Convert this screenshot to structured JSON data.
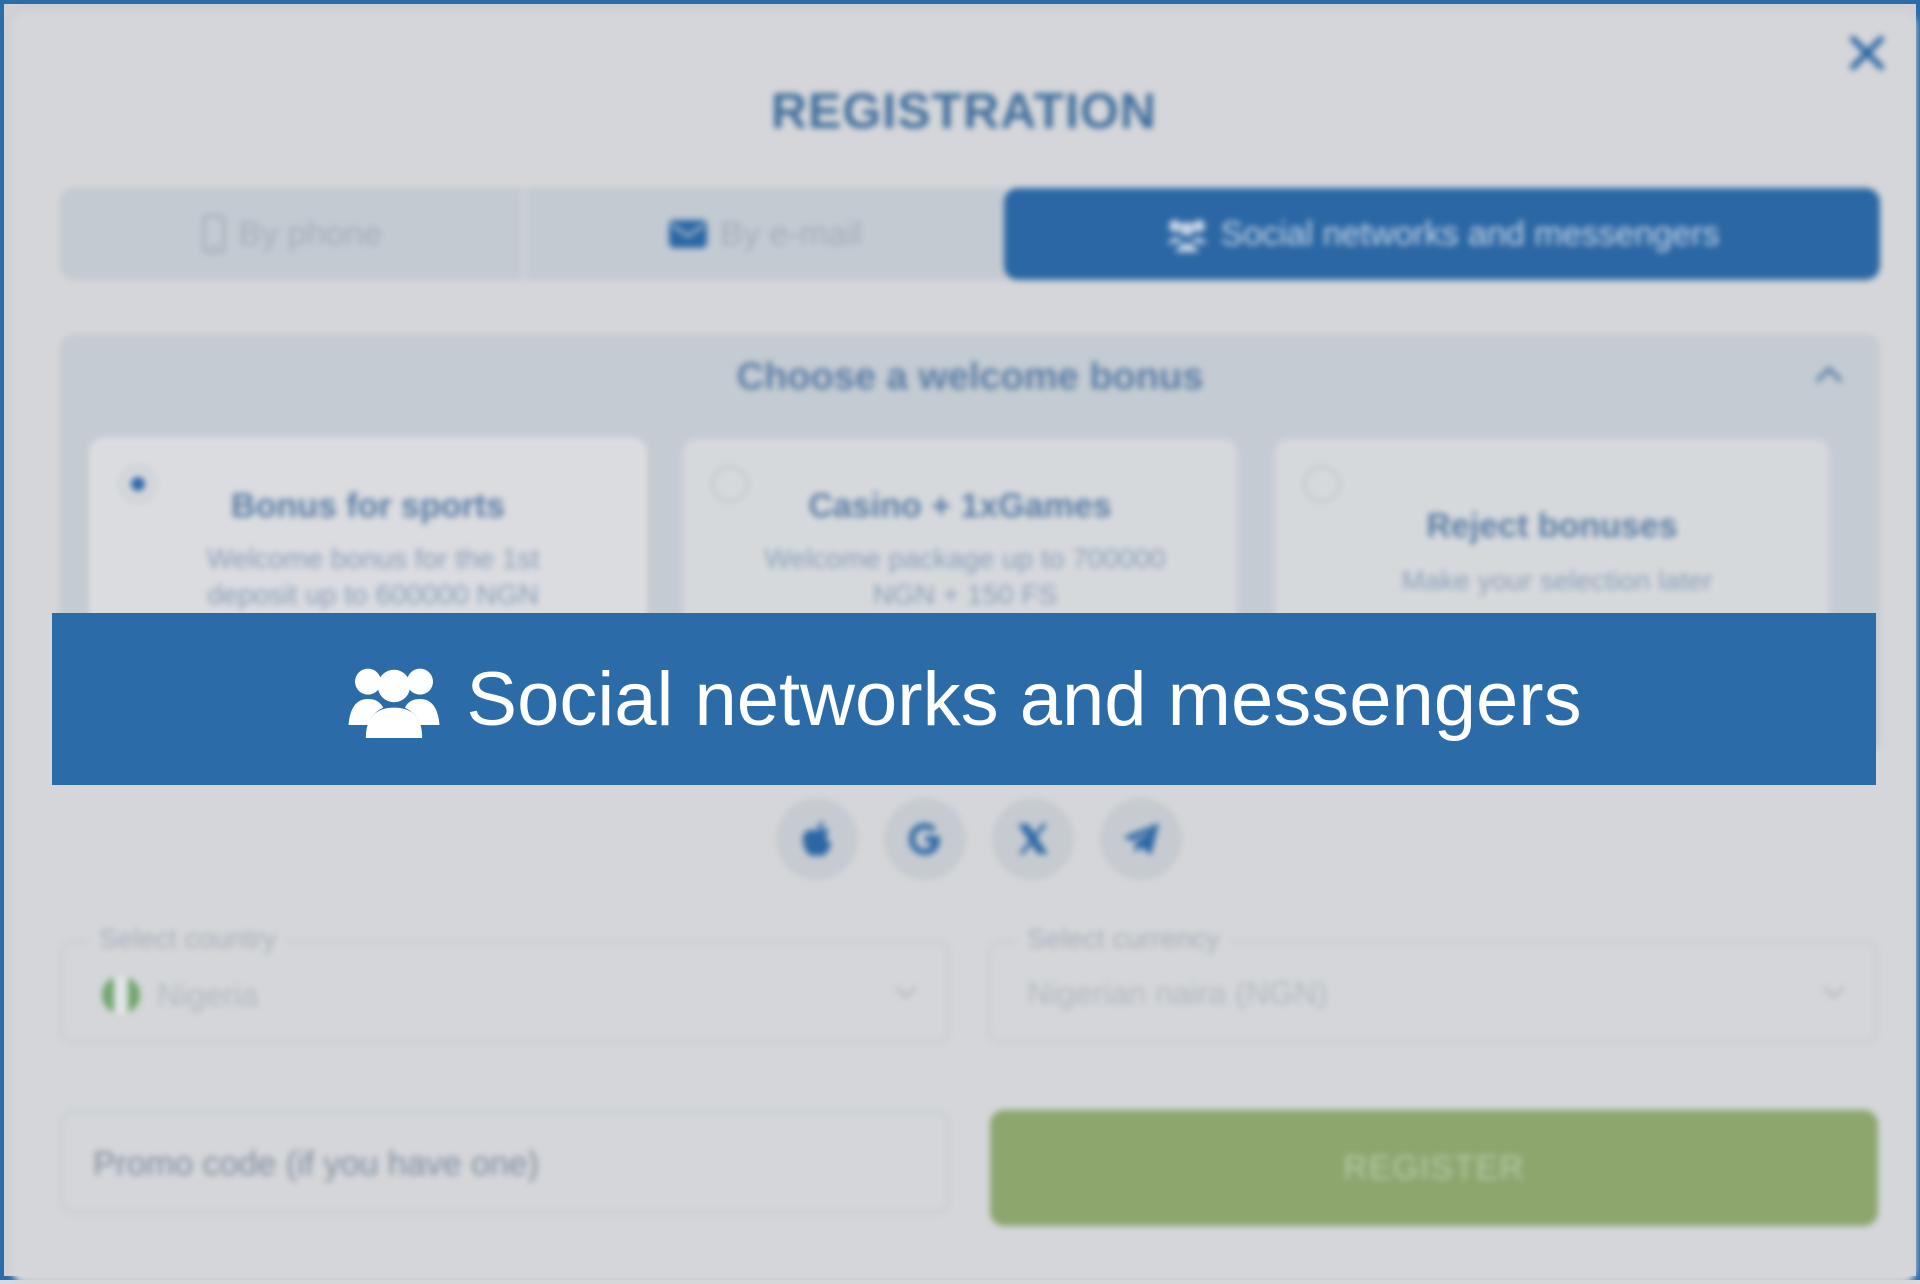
{
  "modal": {
    "title": "REGISTRATION",
    "close_icon": "close-icon"
  },
  "tabs": [
    {
      "label": "By phone",
      "icon": "phone-icon",
      "active": false
    },
    {
      "label": "By e-mail",
      "icon": "envelope-icon",
      "active": false
    },
    {
      "label": "Social networks and messengers",
      "icon": "users-icon",
      "active": true
    }
  ],
  "bonus": {
    "title": "Choose a welcome bonus",
    "cards": [
      {
        "title": "Bonus for sports",
        "desc": "Welcome bonus for the 1st deposit up to 600000 NGN",
        "selected": true
      },
      {
        "title": "Casino + 1xGames",
        "desc": "Welcome package up to 700000 NGN + 150 FS",
        "selected": false
      },
      {
        "title": "Reject bonuses",
        "desc": "Make your selection later",
        "selected": false
      }
    ]
  },
  "socials": [
    "apple-icon",
    "google-icon",
    "x-icon",
    "telegram-icon"
  ],
  "form": {
    "country_label": "Select country",
    "country_value": "Nigeria",
    "currency_label": "Select currency",
    "currency_value": "Nigerian naira (NGN)",
    "promo_placeholder": "Promo code (if you have one)",
    "register_label": "REGISTER"
  },
  "banner": {
    "text": "Social networks and messengers",
    "icon": "users-icon"
  },
  "colors": {
    "brand_blue": "#2b6ca8",
    "register_green": "#8ca66e",
    "modal_bg": "#d4d6d9"
  }
}
